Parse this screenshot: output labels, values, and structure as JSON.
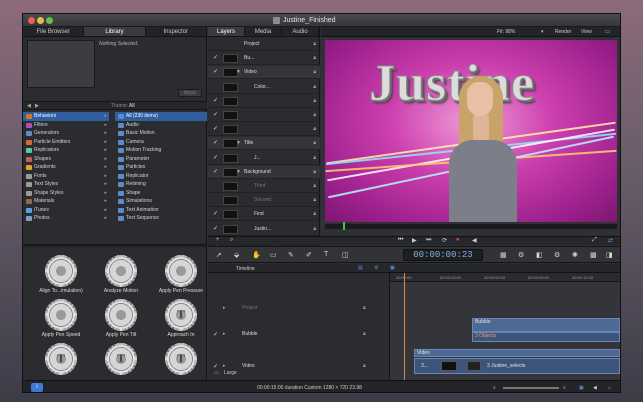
{
  "window": {
    "title": "Justine_Finished"
  },
  "left_tabs": [
    "File Browser",
    "Library",
    "Inspector"
  ],
  "left_active_tab": "Library",
  "preview": {
    "nothing_selected": "Nothing Selected.",
    "apply": "Apply"
  },
  "theme": {
    "label": "Theme:",
    "value": "All"
  },
  "categories": [
    {
      "label": "Behaviors",
      "color": "#c77d2e",
      "selected": true
    },
    {
      "label": "Filters",
      "color": "#b04fb8"
    },
    {
      "label": "Generators",
      "color": "#5b8bc9"
    },
    {
      "label": "Particle Emitters",
      "color": "#d36a3a"
    },
    {
      "label": "Replicators",
      "color": "#5bc9a0"
    },
    {
      "label": "Shapes",
      "color": "#c95b5b"
    },
    {
      "label": "Gradients",
      "color": "#d8a32e"
    },
    {
      "label": "Fonts",
      "color": "#9b9b9b"
    },
    {
      "label": "Text Styles",
      "color": "#9b9b9b"
    },
    {
      "label": "Shape Styles",
      "color": "#9b9b9b"
    },
    {
      "label": "Materials",
      "color": "#8d6b4a"
    },
    {
      "label": "iTunes",
      "color": "#5aa0e0"
    },
    {
      "label": "Photos",
      "color": "#7aa0c8"
    }
  ],
  "items": [
    {
      "label": "All (230 items)",
      "selected": true
    },
    {
      "label": "Audio"
    },
    {
      "label": "Basic Motion"
    },
    {
      "label": "Camera"
    },
    {
      "label": "Motion Tracking"
    },
    {
      "label": "Parameter"
    },
    {
      "label": "Particles"
    },
    {
      "label": "Replicator"
    },
    {
      "label": "Retiming"
    },
    {
      "label": "Shape"
    },
    {
      "label": "Simulations"
    },
    {
      "label": "Text Animation"
    },
    {
      "label": "Text Sequence"
    }
  ],
  "presets": [
    {
      "label": "Align To...imulation)",
      "glyph": ""
    },
    {
      "label": "Analyze Motion",
      "glyph": ""
    },
    {
      "label": "Apply Pen Pressure",
      "glyph": ""
    },
    {
      "label": "Apply Pen Speed",
      "glyph": ""
    },
    {
      "label": "Apply Pen Tilt",
      "glyph": ""
    },
    {
      "label": "Approach In",
      "glyph": "T"
    },
    {
      "label": "",
      "glyph": "T"
    },
    {
      "label": "",
      "glyph": "T"
    },
    {
      "label": "",
      "glyph": "T"
    }
  ],
  "mid_tabs": [
    "Layers",
    "Media",
    "Audio"
  ],
  "layers": [
    {
      "name": "Project",
      "indent": 36,
      "check": "",
      "dim": false,
      "thumb": false,
      "group": false
    },
    {
      "name": "Bu...",
      "indent": 36,
      "check": "✓",
      "dim": false,
      "thumb": true,
      "group": false
    },
    {
      "name": "Video",
      "indent": 36,
      "check": "✓",
      "dim": false,
      "thumb": true,
      "group": true
    },
    {
      "name": "Color...",
      "indent": 46,
      "check": "",
      "dim": false,
      "thumb": true,
      "group": false
    },
    {
      "name": "",
      "indent": 46,
      "check": "✓",
      "dim": false,
      "thumb": true,
      "group": false
    },
    {
      "name": "",
      "indent": 46,
      "check": "✓",
      "dim": false,
      "thumb": true,
      "group": false
    },
    {
      "name": "",
      "indent": 46,
      "check": "✓",
      "dim": false,
      "thumb": true,
      "group": false
    },
    {
      "name": "Title",
      "indent": 36,
      "check": "✓",
      "dim": false,
      "thumb": true,
      "group": true
    },
    {
      "name": "J...",
      "indent": 46,
      "check": "✓",
      "dim": false,
      "thumb": true,
      "group": false
    },
    {
      "name": "Background",
      "indent": 36,
      "check": "✓",
      "dim": false,
      "thumb": true,
      "group": true
    },
    {
      "name": "Third",
      "indent": 46,
      "check": "",
      "dim": true,
      "thumb": true,
      "group": false
    },
    {
      "name": "Second",
      "indent": 46,
      "check": "",
      "dim": true,
      "thumb": true,
      "group": false
    },
    {
      "name": "First",
      "indent": 46,
      "check": "✓",
      "dim": false,
      "thumb": true,
      "group": false
    },
    {
      "name": "Justin...",
      "indent": 46,
      "check": "✓",
      "dim": false,
      "thumb": true,
      "group": false
    }
  ],
  "viewer": {
    "fit": "Fit: 98%",
    "render": "Render",
    "view": "View",
    "canvas_title": "Justine"
  },
  "timecode": "00:00:00:23",
  "timeline": {
    "label": "Timeline",
    "ruler": [
      "00:00:00",
      "00:00:03:00",
      "00:00:06:00",
      "00:00:09:00",
      "00:00:12:00"
    ],
    "tracks": [
      {
        "name": "Project",
        "check": "",
        "dim": true
      },
      {
        "name": "Bubble",
        "check": "✓",
        "dim": false
      },
      {
        "name": "Video",
        "check": "✓",
        "dim": false
      }
    ],
    "clips": {
      "bubble": "Bubble",
      "bubble_sub": "3 Objects",
      "video": "Video",
      "video_sub": "3 Justine_selects",
      "video_label": "3..."
    },
    "large": "Large"
  },
  "status": {
    "text": "00:00:15:00 duration Custom 1280 × 720 23.98"
  }
}
